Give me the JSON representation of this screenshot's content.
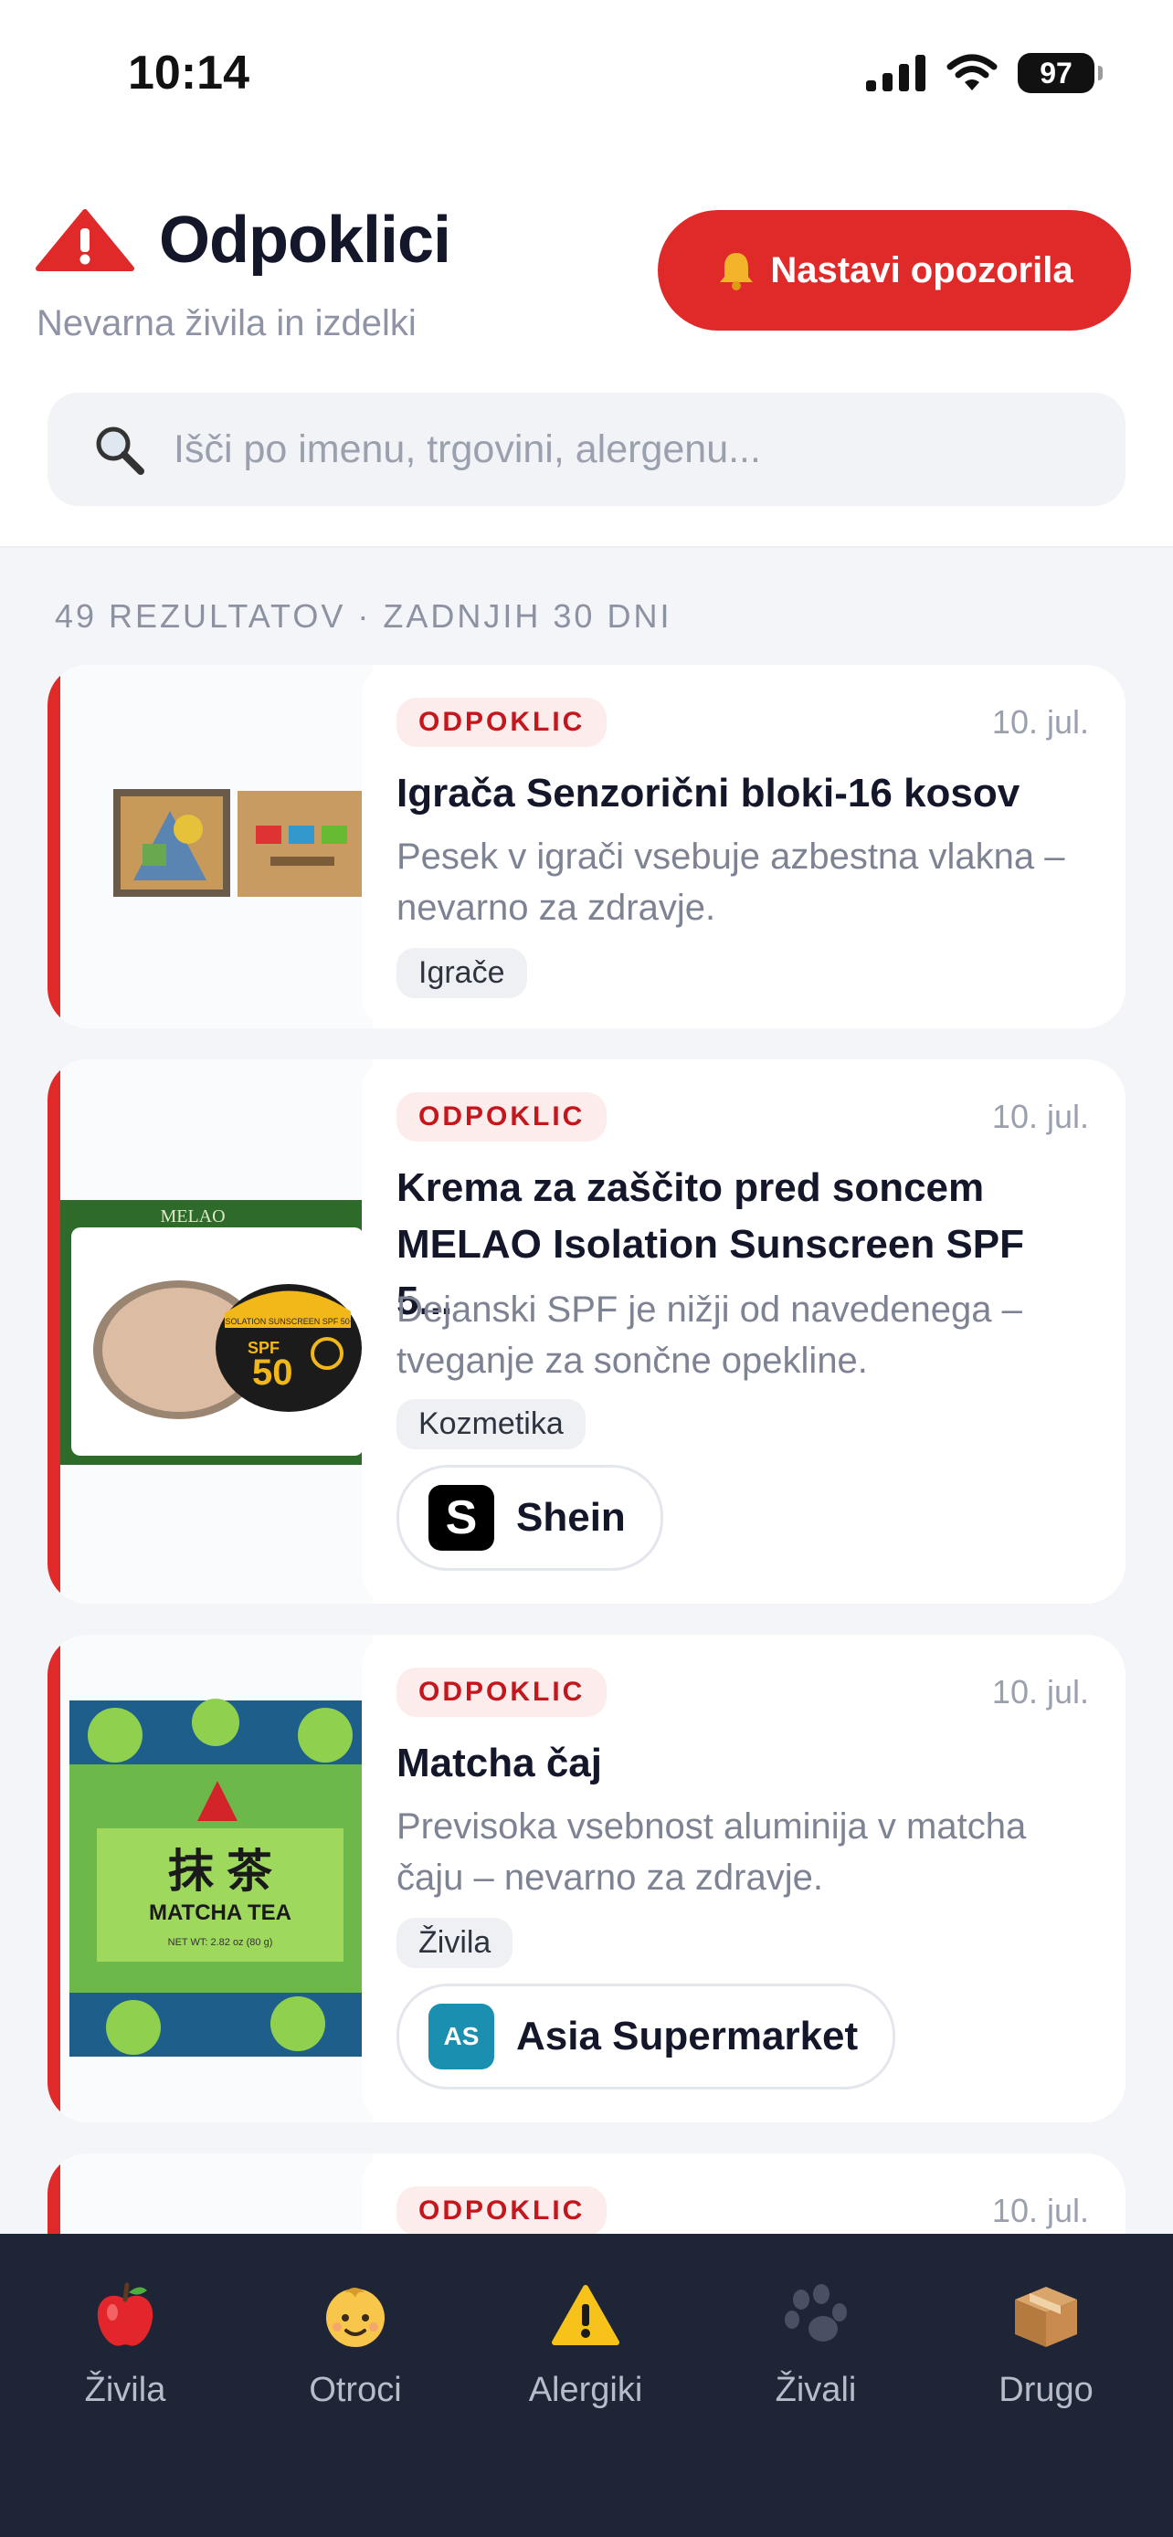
{
  "status_bar": {
    "time": "10:14",
    "battery": "97"
  },
  "header": {
    "title": "Odpoklici",
    "subtitle": "Nevarna živila in izdelki",
    "alert_button": "Nastavi opozorila"
  },
  "search": {
    "placeholder": "Išči po imenu, trgovini, alergenu..."
  },
  "results": {
    "count_label": "49 REZULTATOV · ZADNJIH 30 DNI"
  },
  "cards": [
    {
      "badge": "ODPOKLIC",
      "date": "10. jul.",
      "title": "Igrača Senzorični bloki-16 kosov",
      "description": "Pesek v igrači vsebuje azbestna vlakna – nevarno za zdravje.",
      "category": "Igrače"
    },
    {
      "badge": "ODPOKLIC",
      "date": "10. jul.",
      "title": "Krema za zaščito pred soncem MELAO Isolation Sunscreen SPF 5...",
      "description": "Dejanski SPF je nižji od navedenega – tveganje za sončne opekline.",
      "category": "Kozmetika",
      "store": {
        "name": "Shein",
        "logo": "S"
      },
      "image_text": {
        "brand": "MELAO",
        "spf": "SPF",
        "spf_value": "50",
        "tin_label": "ISOLATION SUNSCREEN SPF 50+"
      }
    },
    {
      "badge": "ODPOKLIC",
      "date": "10. jul.",
      "title": "Matcha čaj",
      "description": "Previsoka vsebnost aluminija v matcha čaju – nevarno za zdravje.",
      "category": "Živila",
      "store": {
        "name": "Asia Supermarket",
        "logo": "AS"
      },
      "image_text": {
        "chinese": "抹 茶",
        "label": "MATCHA TEA",
        "weight": "NET WT: 2.82 oz (80 g)"
      }
    },
    {
      "badge": "ODPOKLIC",
      "date": "10. jul."
    }
  ],
  "tabs": [
    {
      "label": "Živila",
      "icon": "apple-icon"
    },
    {
      "label": "Otroci",
      "icon": "baby-icon"
    },
    {
      "label": "Alergiki",
      "icon": "warning-icon"
    },
    {
      "label": "Živali",
      "icon": "paw-icon"
    },
    {
      "label": "Drugo",
      "icon": "box-icon"
    }
  ],
  "colors": {
    "accent": "#e02a2a",
    "tabbar": "#1e2537",
    "badge_bg": "#fdecec"
  }
}
